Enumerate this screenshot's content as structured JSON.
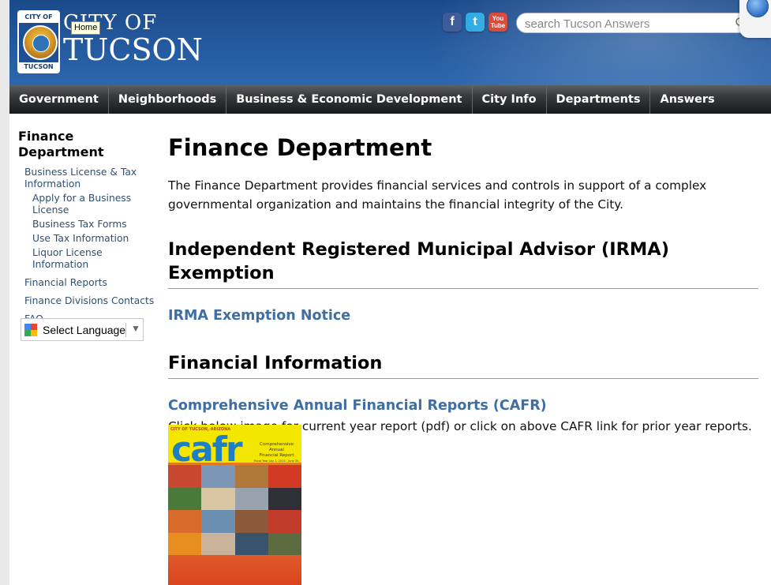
{
  "header": {
    "seal_top": "CITY OF",
    "seal_bottom": "TUCSON",
    "wordmark_line1": "CITY OF",
    "wordmark_line2": "TUCSON",
    "tooltip": "Home",
    "social": [
      {
        "name": "facebook-icon",
        "glyph": "f"
      },
      {
        "name": "twitter-icon",
        "glyph": "t"
      },
      {
        "name": "youtube-icon",
        "glyph": "You Tube"
      }
    ],
    "search_placeholder": "search Tucson Answers"
  },
  "nav": {
    "items": [
      "Government",
      "Neighborhoods",
      "Business & Economic Development",
      "City Info",
      "Departments",
      "Answers"
    ]
  },
  "sidebar": {
    "title": "Finance Department",
    "items": [
      {
        "label": "Business License & Tax Information",
        "level": 1
      },
      {
        "label": "Apply for a Business License",
        "level": 2
      },
      {
        "label": "Business Tax Forms",
        "level": 2
      },
      {
        "label": "Use Tax Information",
        "level": 2
      },
      {
        "label": "Liquor License Information",
        "level": 2
      },
      {
        "label": "Financial Reports",
        "level": 1
      },
      {
        "label": "Finance Divisions Contacts",
        "level": 1
      },
      {
        "label": "FAQ",
        "level": 1
      }
    ],
    "language_label": "Select Language"
  },
  "main": {
    "title": "Finance Department",
    "intro": "The Finance Department provides financial services and controls in support of a complex governmental organization and maintains the financial integrity of the City.",
    "irma_heading": "Independent Registered Municipal Advisor (IRMA) Exemption",
    "irma_link": "IRMA Exemption Notice",
    "fin_heading": "Financial Information",
    "cafr_link": "Comprehensive Annual Financial Reports (CAFR)",
    "cafr_note": "Click below image for current year report (pdf) or click on above CAFR link for prior year reports.",
    "cover": {
      "top_text": "CITY OF TUCSON, ARIZONA",
      "word": "cafr",
      "subtitle_1": "Comprehensive Annual",
      "subtitle_2": "Financial Report",
      "subtitle_3": "Fiscal Year July 1, 2012 - June 30, 2013"
    }
  },
  "colors": {
    "header_blue": "#245a9f",
    "nav_dark": "#18191a",
    "link_blue": "#3f6ea3",
    "cafr_yellow": "#f3e600"
  }
}
